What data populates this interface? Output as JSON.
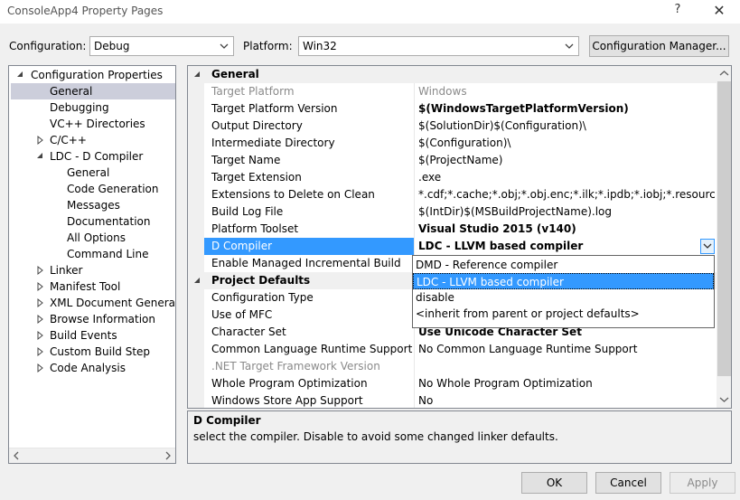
{
  "window": {
    "title": "ConsoleApp4 Property Pages",
    "help": "?",
    "close": "✕"
  },
  "config": {
    "configuration_label": "Configuration:",
    "configuration_value": "Debug",
    "platform_label": "Platform:",
    "platform_value": "Win32",
    "manager_button": "Configuration Manager..."
  },
  "tree": {
    "items": [
      {
        "label": "Configuration Properties"
      },
      {
        "label": "General"
      },
      {
        "label": "Debugging"
      },
      {
        "label": "VC++ Directories"
      },
      {
        "label": "C/C++"
      },
      {
        "label": "LDC - D Compiler"
      },
      {
        "label": "General"
      },
      {
        "label": "Code Generation"
      },
      {
        "label": "Messages"
      },
      {
        "label": "Documentation"
      },
      {
        "label": "All Options"
      },
      {
        "label": "Command Line"
      },
      {
        "label": "Linker"
      },
      {
        "label": "Manifest Tool"
      },
      {
        "label": "XML Document Generator"
      },
      {
        "label": "Browse Information"
      },
      {
        "label": "Build Events"
      },
      {
        "label": "Custom Build Step"
      },
      {
        "label": "Code Analysis"
      }
    ]
  },
  "grid": {
    "rows": [
      {
        "name": "General",
        "value": ""
      },
      {
        "name": "Target Platform",
        "value": "Windows"
      },
      {
        "name": "Target Platform Version",
        "value": "$(WindowsTargetPlatformVersion)"
      },
      {
        "name": "Output Directory",
        "value": "$(SolutionDir)$(Configuration)\\"
      },
      {
        "name": "Intermediate Directory",
        "value": "$(Configuration)\\"
      },
      {
        "name": "Target Name",
        "value": "$(ProjectName)"
      },
      {
        "name": "Target Extension",
        "value": ".exe"
      },
      {
        "name": "Extensions to Delete on Clean",
        "value": "*.cdf;*.cache;*.obj;*.obj.enc;*.ilk;*.ipdb;*.iobj;*.resources;*.tlb;*"
      },
      {
        "name": "Build Log File",
        "value": "$(IntDir)$(MSBuildProjectName).log"
      },
      {
        "name": "Platform Toolset",
        "value": "Visual Studio 2015 (v140)"
      },
      {
        "name": "D Compiler",
        "value": "LDC - LLVM based compiler"
      },
      {
        "name": "Enable Managed Incremental Build",
        "value": ""
      },
      {
        "name": "Project Defaults",
        "value": ""
      },
      {
        "name": "Configuration Type",
        "value": ""
      },
      {
        "name": "Use of MFC",
        "value": ""
      },
      {
        "name": "Character Set",
        "value": "Use Unicode Character Set"
      },
      {
        "name": "Common Language Runtime Support",
        "value": "No Common Language Runtime Support"
      },
      {
        "name": ".NET Target Framework Version",
        "value": ""
      },
      {
        "name": "Whole Program Optimization",
        "value": "No Whole Program Optimization"
      },
      {
        "name": "Windows Store App Support",
        "value": "No"
      }
    ]
  },
  "dropdown": {
    "options": [
      {
        "label": "DMD - Reference compiler"
      },
      {
        "label": "LDC - LLVM based compiler"
      },
      {
        "label": "disable"
      },
      {
        "label": "<inherit from parent or project defaults>"
      }
    ]
  },
  "description": {
    "title": "D Compiler",
    "text": "select the compiler. Disable to avoid some changed linker defaults."
  },
  "buttons": {
    "ok": "OK",
    "cancel": "Cancel",
    "apply": "Apply"
  },
  "colors": {
    "accent": "#3399ff",
    "selected_tree": "#cccedb",
    "disabled_text": "#8a8a8a"
  }
}
